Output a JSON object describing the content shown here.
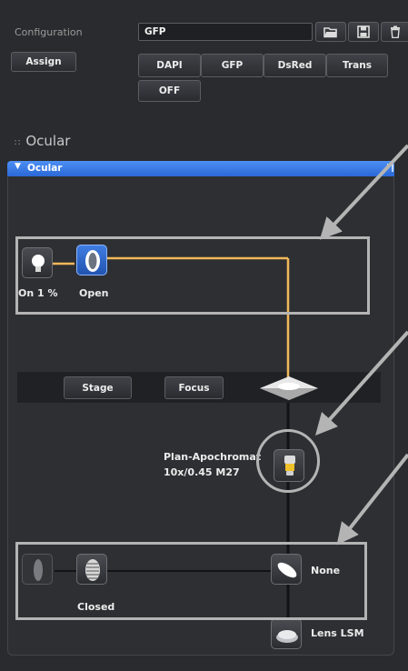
{
  "configuration": {
    "label": "Configuration",
    "current_value": "GFP",
    "assign_label": "Assign",
    "filter_buttons": [
      "DAPI",
      "GFP",
      "DsRed",
      "Trans"
    ],
    "off_label": "OFF"
  },
  "ocular": {
    "section_title": "Ocular",
    "panel_title": "Ocular",
    "lamp_status": "On 1 %",
    "shutter_status": "Open",
    "stage_label": "Stage",
    "focus_label": "Focus",
    "objective_line1": "Plan-Apochromat",
    "objective_line2": "10x/0.45 M27",
    "lower_shutter_status": "Closed",
    "reflector_label": "None",
    "lens_label": "Lens LSM"
  },
  "colors": {
    "panel_bg": "#2a2b2e",
    "accent_blue": "#3d7de8",
    "light_path": "#f2b85a",
    "callout": "#b4b4b4"
  }
}
